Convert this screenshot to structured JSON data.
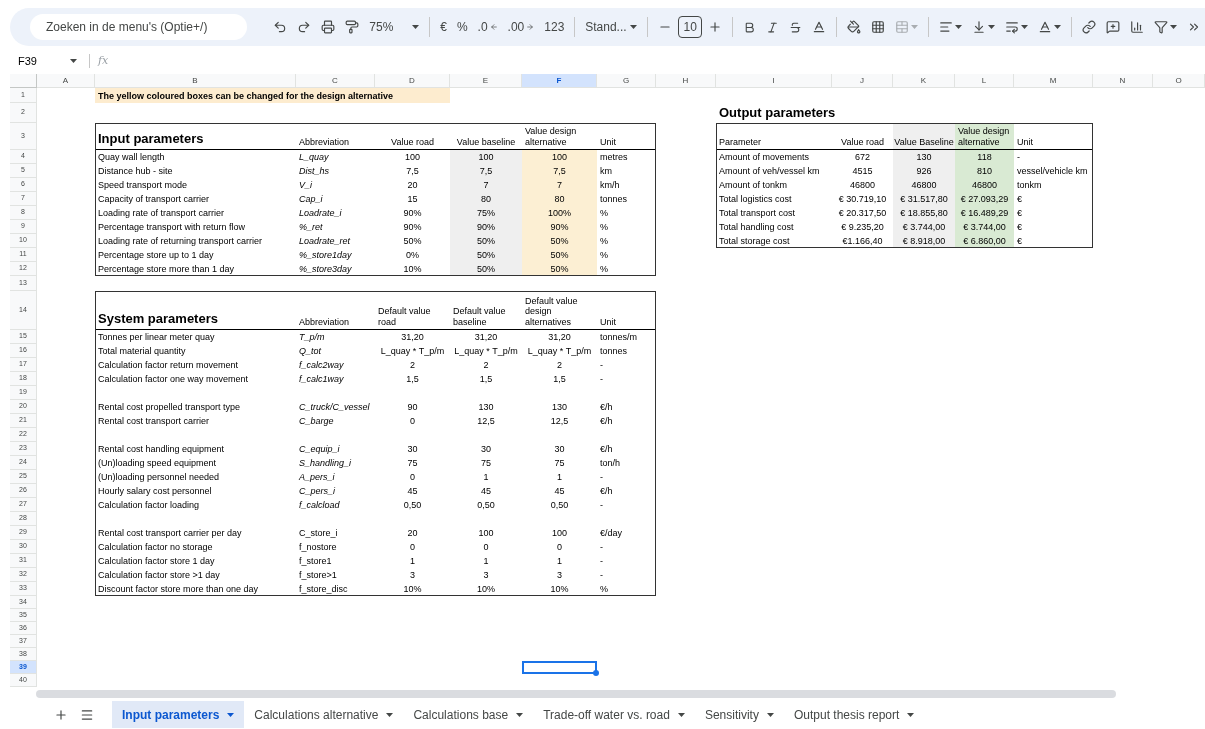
{
  "toolbar": {
    "search": {
      "placeholder": "Zoeken in de menu's (Optie+/)"
    },
    "zoom": "75%",
    "currency": "€",
    "percent": "%",
    "decrease_decimals": ".0",
    "increase_decimals": ".00",
    "number_format": "123",
    "font": "Stand...",
    "font_size": "10"
  },
  "formula_bar": {
    "name_box": "F39",
    "fx": "fx"
  },
  "column_headers": [
    {
      "label": "A",
      "selected": false
    },
    {
      "label": "B",
      "selected": false
    },
    {
      "label": "C",
      "selected": false
    },
    {
      "label": "D",
      "selected": false
    },
    {
      "label": "E",
      "selected": false
    },
    {
      "label": "F",
      "selected": true
    },
    {
      "label": "G",
      "selected": false
    },
    {
      "label": "H",
      "selected": false
    },
    {
      "label": "I",
      "selected": false
    },
    {
      "label": "J",
      "selected": false
    },
    {
      "label": "K",
      "selected": false
    },
    {
      "label": "L",
      "selected": false
    },
    {
      "label": "M",
      "selected": false
    },
    {
      "label": "N",
      "selected": false
    },
    {
      "label": "O",
      "selected": false
    }
  ],
  "row_numbers": [
    {
      "label": "1",
      "selected": false
    },
    {
      "label": "2",
      "selected": false
    },
    {
      "label": "3",
      "selected": false
    },
    {
      "label": "4",
      "selected": false
    },
    {
      "label": "5",
      "selected": false
    },
    {
      "label": "6",
      "selected": false
    },
    {
      "label": "7",
      "selected": false
    },
    {
      "label": "8",
      "selected": false
    },
    {
      "label": "9",
      "selected": false
    },
    {
      "label": "10",
      "selected": false
    },
    {
      "label": "11",
      "selected": false
    },
    {
      "label": "12",
      "selected": false
    },
    {
      "label": "13",
      "selected": false
    },
    {
      "label": "14",
      "selected": false
    },
    {
      "label": "15",
      "selected": false
    },
    {
      "label": "16",
      "selected": false
    },
    {
      "label": "17",
      "selected": false
    },
    {
      "label": "18",
      "selected": false
    },
    {
      "label": "19",
      "selected": false
    },
    {
      "label": "20",
      "selected": false
    },
    {
      "label": "21",
      "selected": false
    },
    {
      "label": "22",
      "selected": false
    },
    {
      "label": "23",
      "selected": false
    },
    {
      "label": "24",
      "selected": false
    },
    {
      "label": "25",
      "selected": false
    },
    {
      "label": "26",
      "selected": false
    },
    {
      "label": "27",
      "selected": false
    },
    {
      "label": "28",
      "selected": false
    },
    {
      "label": "29",
      "selected": false
    },
    {
      "label": "30",
      "selected": false
    },
    {
      "label": "31",
      "selected": false
    },
    {
      "label": "32",
      "selected": false
    },
    {
      "label": "33",
      "selected": false
    },
    {
      "label": "34",
      "selected": false
    },
    {
      "label": "35",
      "selected": false
    },
    {
      "label": "36",
      "selected": false
    },
    {
      "label": "37",
      "selected": false
    },
    {
      "label": "38",
      "selected": false
    },
    {
      "label": "39",
      "selected": true
    },
    {
      "label": "40",
      "selected": false
    }
  ],
  "note": "The yellow coloured boxes can be changed for the design alternative",
  "input_parameters": {
    "title": "Input parameters",
    "columns": [
      "Abbreviation",
      "Value road",
      "Value baseline",
      "Value design alternative",
      "Unit"
    ],
    "rows": [
      {
        "parameter": "Quay wall length",
        "abbreviation": "L_quay",
        "italic": true,
        "road": "100",
        "baseline": "100",
        "design": "100",
        "unit": "metres"
      },
      {
        "parameter": "Distance hub - site",
        "abbreviation": "Dist_hs",
        "italic": true,
        "road": "7,5",
        "baseline": "7,5",
        "design": "7,5",
        "unit": "km"
      },
      {
        "parameter": "Speed transport mode",
        "abbreviation": "V_i",
        "italic": true,
        "road": "20",
        "baseline": "7",
        "design": "7",
        "unit": "km/h"
      },
      {
        "parameter": "Capacity of transport carrier",
        "abbreviation": "Cap_i",
        "italic": true,
        "road": "15",
        "baseline": "80",
        "design": "80",
        "unit": "tonnes"
      },
      {
        "parameter": "Loading rate of transport carrier",
        "abbreviation": "Loadrate_i",
        "italic": true,
        "road": "90%",
        "baseline": "75%",
        "design": "100%",
        "unit": "%"
      },
      {
        "parameter": "Percentage transport with return flow",
        "abbreviation": "%_ret",
        "italic": true,
        "road": "90%",
        "baseline": "90%",
        "design": "90%",
        "unit": "%"
      },
      {
        "parameter": "Loading rate of returning transport carrier",
        "abbreviation": "Loadrate_ret",
        "italic": true,
        "road": "50%",
        "baseline": "50%",
        "design": "50%",
        "unit": "%"
      },
      {
        "parameter": "Percentage store up to 1 day",
        "abbreviation": "%_store1day",
        "italic": true,
        "road": "0%",
        "baseline": "50%",
        "design": "50%",
        "unit": "%"
      },
      {
        "parameter": "Percentage store more than 1 day",
        "abbreviation": "%_store3day",
        "italic": true,
        "road": "10%",
        "baseline": "50%",
        "design": "50%",
        "unit": "%"
      }
    ]
  },
  "system_parameters": {
    "title": "System parameters",
    "columns": [
      "Abbreviation",
      "Default value road",
      "Default value baseline",
      "Default value design alternatives",
      "Unit"
    ],
    "groups": [
      [
        {
          "parameter": "Tonnes per linear meter quay",
          "abbreviation": "T_p/m",
          "italic": true,
          "road": "31,20",
          "baseline": "31,20",
          "design": "31,20",
          "unit": "tonnes/m"
        },
        {
          "parameter": "Total material quantity",
          "abbreviation": "Q_tot",
          "italic": true,
          "road": "L_quay * T_p/m",
          "baseline": "L_quay * T_p/m",
          "design": "L_quay * T_p/m",
          "unit": "tonnes"
        },
        {
          "parameter": "Calculation factor return movement",
          "abbreviation": "f_calc2way",
          "italic": true,
          "road": "2",
          "baseline": "2",
          "design": "2",
          "unit": "-"
        },
        {
          "parameter": "Calculation factor one way movement",
          "abbreviation": "f_calc1way",
          "italic": true,
          "road": "1,5",
          "baseline": "1,5",
          "design": "1,5",
          "unit": "-"
        }
      ],
      [
        {
          "parameter": "Rental cost propelled transport type",
          "abbreviation": "C_truck/C_vessel",
          "italic": true,
          "road": "90",
          "baseline": "130",
          "design": "130",
          "unit": "€/h"
        },
        {
          "parameter": "Rental cost transport carrier",
          "abbreviation": "C_barge",
          "italic": true,
          "road": "0",
          "baseline": "12,5",
          "design": "12,5",
          "unit": "€/h"
        }
      ],
      [
        {
          "parameter": "Rental cost handling equipment",
          "abbreviation": "C_equip_i",
          "italic": true,
          "road": "30",
          "baseline": "30",
          "design": "30",
          "unit": "€/h"
        },
        {
          "parameter": "(Un)loading speed equipment",
          "abbreviation": "S_handling_i",
          "italic": true,
          "road": "75",
          "baseline": "75",
          "design": "75",
          "unit": "ton/h"
        },
        {
          "parameter": "(Un)loading personnel needed",
          "abbreviation": "A_pers_i",
          "italic": true,
          "road": "0",
          "baseline": "1",
          "design": "1",
          "unit": "-"
        },
        {
          "parameter": "Hourly salary cost personnel",
          "abbreviation": "C_pers_i",
          "italic": true,
          "road": "45",
          "baseline": "45",
          "design": "45",
          "unit": "€/h"
        },
        {
          "parameter": "Calculation factor loading",
          "abbreviation": "f_calcload",
          "italic": true,
          "road": "0,50",
          "baseline": "0,50",
          "design": "0,50",
          "unit": "-"
        }
      ],
      [
        {
          "parameter": "Rental cost transport carrier per day",
          "abbreviation": "C_store_i",
          "italic": false,
          "road": "20",
          "baseline": "100",
          "design": "100",
          "unit": "€/day"
        },
        {
          "parameter": "Calculation factor no storage",
          "abbreviation": "f_nostore",
          "italic": false,
          "road": "0",
          "baseline": "0",
          "design": "0",
          "unit": "-"
        },
        {
          "parameter": "Calculation factor store 1 day",
          "abbreviation": "f_store1",
          "italic": false,
          "road": "1",
          "baseline": "1",
          "design": "1",
          "unit": "-"
        },
        {
          "parameter": "Calculation factor store >1 day",
          "abbreviation": "f_store>1",
          "italic": false,
          "road": "3",
          "baseline": "3",
          "design": "3",
          "unit": "-"
        },
        {
          "parameter": "Discount factor store more than one day",
          "abbreviation": "f_store_disc",
          "italic": false,
          "road": "10%",
          "baseline": "10%",
          "design": "10%",
          "unit": "%"
        }
      ]
    ]
  },
  "output_parameters": {
    "title": "Output parameters",
    "columns": [
      "Parameter",
      "Value road",
      "Value Baseline",
      "Value design alternative",
      "Unit"
    ],
    "rows": [
      {
        "parameter": "Amount of movements",
        "road": "672",
        "baseline": "130",
        "design": "118",
        "unit": "-"
      },
      {
        "parameter": "Amount of veh/vessel km",
        "road": "4515",
        "baseline": "926",
        "design": "810",
        "unit": "vessel/vehicle km"
      },
      {
        "parameter": "Amount of tonkm",
        "road": "46800",
        "baseline": "46800",
        "design": "46800",
        "unit": "tonkm"
      },
      {
        "parameter": "Total logistics cost",
        "road": "€ 30.719,10",
        "baseline": "€ 31.517,80",
        "design": "€ 27.093,29",
        "unit": "€"
      },
      {
        "parameter": "Total transport cost",
        "road": "€ 20.317,50",
        "baseline": "€ 18.855,80",
        "design": "€ 16.489,29",
        "unit": "€"
      },
      {
        "parameter": "Total handling cost",
        "road": "€ 9.235,20",
        "baseline": "€ 3.744,00",
        "design": "€ 3.744,00",
        "unit": "€"
      },
      {
        "parameter": "Total storage cost",
        "road": "€1.166,40",
        "baseline": "€ 8.918,00",
        "design": "€ 6.860,00",
        "unit": "€"
      }
    ]
  },
  "sheet_tabs": [
    {
      "label": "Input parameters",
      "selected": true
    },
    {
      "label": "Calculations alternative",
      "selected": false
    },
    {
      "label": "Calculations base",
      "selected": false
    },
    {
      "label": "Trade-off water vs. road",
      "selected": false
    },
    {
      "label": "Sensitivity",
      "selected": false
    },
    {
      "label": "Output thesis report",
      "selected": false
    }
  ]
}
